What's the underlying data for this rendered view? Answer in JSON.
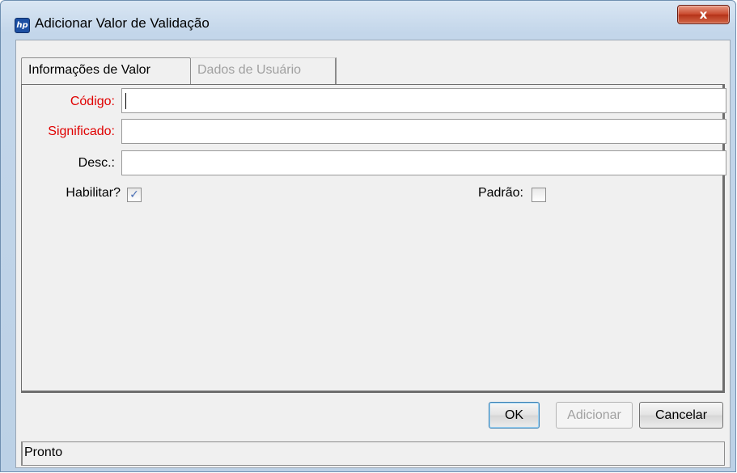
{
  "window": {
    "title": "Adicionar Valor de Validação",
    "logo_icon": "hp-logo-icon",
    "close_label": "x"
  },
  "tabs": [
    {
      "label": "Informações de Valor",
      "active": true
    },
    {
      "label": "Dados de Usuário",
      "active": false
    }
  ],
  "form": {
    "code_label": "Código:",
    "code_value": "",
    "meaning_label": "Significado:",
    "meaning_value": "",
    "desc_label": "Desc.:",
    "desc_value": "",
    "enable_label": "Habilitar?",
    "enable_checked": true,
    "default_label": "Padrão:",
    "default_checked": false
  },
  "buttons": {
    "ok": "OK",
    "add": "Adicionar",
    "cancel": "Cancelar"
  },
  "status": "Pronto",
  "colors": {
    "required_label": "#e00000",
    "close_button": "#c8472b",
    "disabled_text": "#a0a0a0"
  }
}
